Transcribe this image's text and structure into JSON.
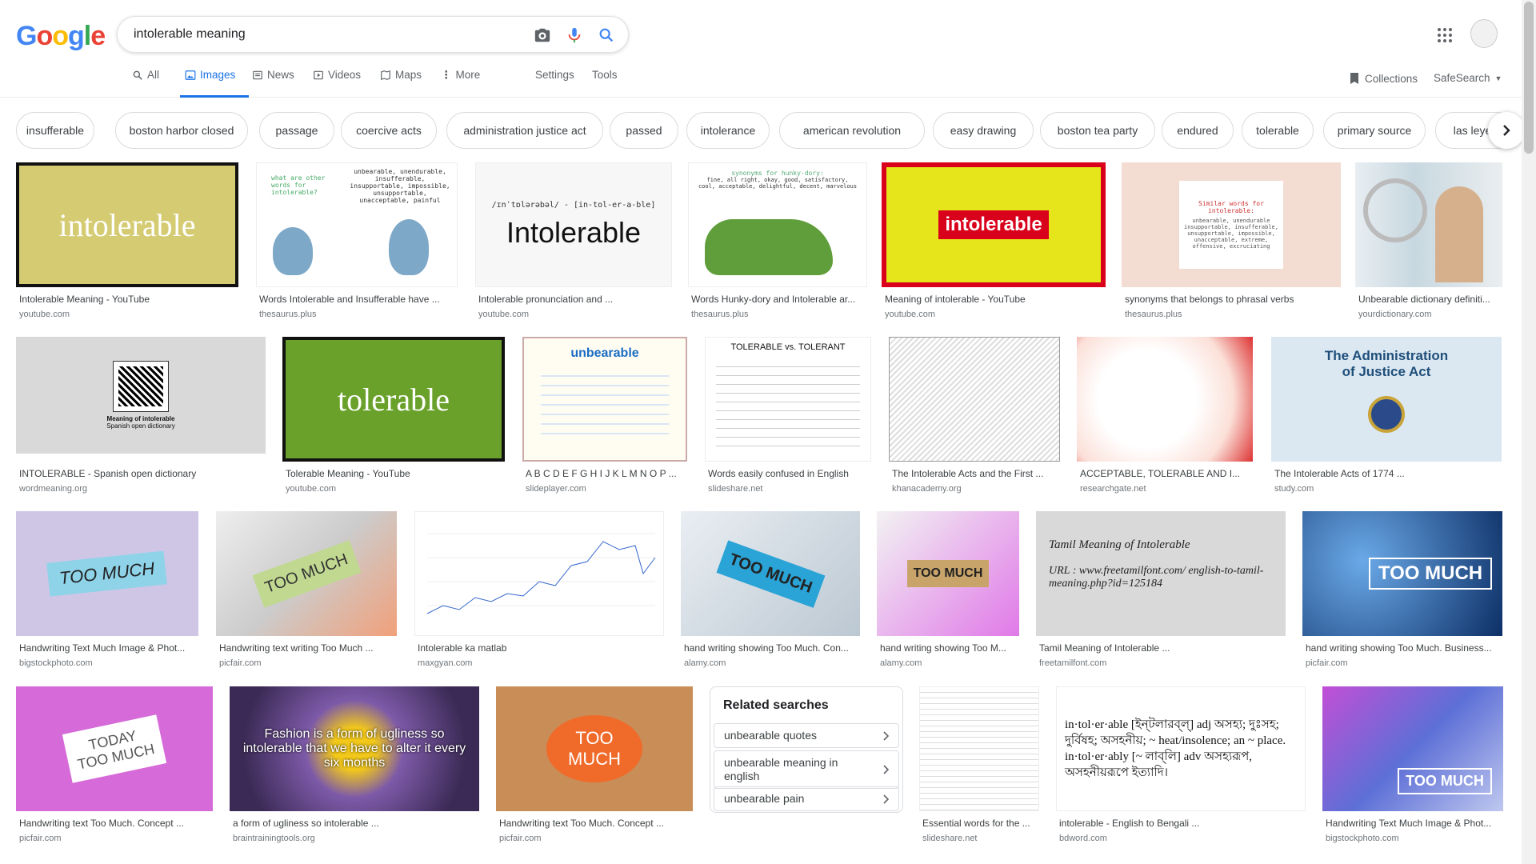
{
  "search": {
    "query": "intolerable meaning"
  },
  "logo": {
    "letters": [
      "G",
      "o",
      "o",
      "g",
      "l",
      "e"
    ]
  },
  "tabs": [
    {
      "label": "All",
      "icon": "search-icon"
    },
    {
      "label": "Images",
      "icon": "image-icon"
    },
    {
      "label": "News",
      "icon": "news-icon"
    },
    {
      "label": "Videos",
      "icon": "video-icon"
    },
    {
      "label": "Maps",
      "icon": "map-icon"
    },
    {
      "label": "More",
      "icon": "more-vertical-icon"
    },
    {
      "label": "Settings"
    },
    {
      "label": "Tools"
    }
  ],
  "toolbar": {
    "collections": "Collections",
    "safesearch": "SafeSearch"
  },
  "chips": [
    "insufferable",
    "boston harbor closed",
    "passage",
    "coercive acts",
    "administration justice act",
    "passed",
    "intolerance",
    "american revolution",
    "easy drawing",
    "boston tea party",
    "endured",
    "tolerable",
    "primary source",
    "las leyes"
  ],
  "results": [
    {
      "title": "Intolerable Meaning - YouTube",
      "source": "youtube.com",
      "thumb_text": "intolerable"
    },
    {
      "title": "Words Intolerable and Insufferable have ...",
      "source": "thesaurus.plus",
      "thumb_text": "unbearable, unendurable, insufferable, insupportable, impossible, unsupportable, unacceptable, painful",
      "thumb_sub": "what are other words for intolerable?"
    },
    {
      "title": "Intolerable pronunciation and ...",
      "source": "youtube.com",
      "thumb_text": "Intolerable",
      "thumb_sub": "/ɪnˈtɒlərəbəl/ - [in-tol-er-a-ble]"
    },
    {
      "title": "Words Hunky-dory and Intolerable ar...",
      "source": "thesaurus.plus",
      "thumb_text": "synonyms for hunky-dory:",
      "thumb_sub": "fine, all right, okay, good, satisfactory, cool, acceptable, delightful, decent, marvelous"
    },
    {
      "title": "Meaning of intolerable - YouTube",
      "source": "youtube.com",
      "thumb_text": "intolerable"
    },
    {
      "title": "synonyms that belongs to phrasal verbs",
      "source": "thesaurus.plus",
      "thumb_text": "Similar words for intolerable:",
      "thumb_sub": "unbearable, unendurable insupportable, insufferable, unsupportable, impossible, unacceptable, extreme, offensive, excruciating"
    },
    {
      "title": "Unbearable dictionary definiti...",
      "source": "yourdictionary.com"
    },
    {
      "title": "INTOLERABLE - Spanish open dictionary",
      "source": "wordmeaning.org",
      "thumb_text": "Meaning of intolerable",
      "thumb_sub": "Spanish open dictionary"
    },
    {
      "title": "Tolerable Meaning - YouTube",
      "source": "youtube.com",
      "thumb_text": "tolerable"
    },
    {
      "title": "A B C D E F G H I J K L M N O P ...",
      "source": "slideplayer.com",
      "thumb_text": "unbearable"
    },
    {
      "title": "Words easily confused in English",
      "source": "slideshare.net",
      "thumb_text": "TOLERABLE vs. TOLERANT"
    },
    {
      "title": "The Intolerable Acts and the First ...",
      "source": "khanacademy.org"
    },
    {
      "title": "ACCEPTABLE, TOLERABLE AND I...",
      "source": "researchgate.net"
    },
    {
      "title": "The Intolerable Acts of 1774 ...",
      "source": "study.com",
      "thumb_text": "The Administration of Justice Act"
    },
    {
      "title": "Handwriting Text Much Image & Phot...",
      "source": "bigstockphoto.com",
      "thumb_text": "TOO MUCH"
    },
    {
      "title": "Handwriting text writing Too Much ...",
      "source": "picfair.com",
      "thumb_text": "TOO MUCH"
    },
    {
      "title": "Intolerable ka matlab",
      "source": "maxgyan.com"
    },
    {
      "title": "hand writing showing Too Much. Con...",
      "source": "alamy.com",
      "thumb_text": "TOO MUCH"
    },
    {
      "title": "hand writing showing Too M...",
      "source": "alamy.com",
      "thumb_text": "TOO MUCH"
    },
    {
      "title": "Tamil Meaning of Intolerable ...",
      "source": "freetamilfont.com",
      "thumb_text": "Tamil Meaning of Intolerable",
      "thumb_sub": "URL : www.freetamilfont.com/ english-to-tamil-meaning.php?id=125184"
    },
    {
      "title": "hand writing showing Too Much. Business...",
      "source": "picfair.com",
      "thumb_text": "TOO MUCH"
    },
    {
      "title": "Handwriting text Too Much. Concept ...",
      "source": "picfair.com",
      "thumb_text": "TODAY TOO MUCH"
    },
    {
      "title": "a form of ugliness so intolerable ...",
      "source": "braintrainingtools.org",
      "thumb_text": "Fashion is a form of ugliness so intolerable that we have to alter it every six months"
    },
    {
      "title": "Handwriting text Too Much. Concept ...",
      "source": "picfair.com",
      "thumb_text": "TOO MUCH"
    },
    {
      "title": "Essential words for the ...",
      "source": "slideshare.net"
    },
    {
      "title": "intolerable - English to Bengali ...",
      "source": "bdword.com",
      "thumb_text": "in·tol·er·able [ইন্‌টলারব্‌ল্‌] adj অসহ্য; দুঃসহ; দুর্বিষহ; অসহনীয়; ~ heat/insolence; an ~ place. in·tol·er·ably [~ লাব্‌লি] adv অসহ্যরূপ, অসহনীয়রূপে ইত্যাদি।"
    },
    {
      "title": "Handwriting Text Much Image & Phot...",
      "source": "bigstockphoto.com",
      "thumb_text": "TOO MUCH"
    }
  ],
  "related": {
    "title": "Related searches",
    "items": [
      "unbearable quotes",
      "unbearable meaning in english",
      "unbearable pain"
    ]
  }
}
